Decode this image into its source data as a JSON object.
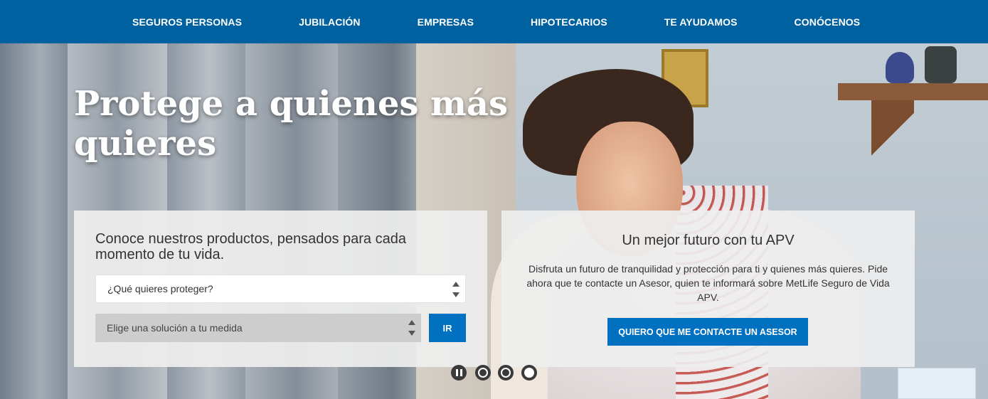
{
  "nav": {
    "items": [
      {
        "label": "SEGUROS PERSONAS"
      },
      {
        "label": "JUBILACIÓN"
      },
      {
        "label": "EMPRESAS"
      },
      {
        "label": "HIPOTECARIOS"
      },
      {
        "label": "TE AYUDAMOS"
      },
      {
        "label": "CONÓCENOS"
      }
    ]
  },
  "hero": {
    "headline": "Protege a quienes más quieres"
  },
  "product_panel": {
    "title": "Conoce nuestros productos, pensados para cada momento de tu vida.",
    "protect_select": "¿Qué quieres proteger?",
    "solution_select": "Elige una solución a tu medida",
    "go_label": "IR"
  },
  "apv_panel": {
    "title": "Un mejor futuro con tu APV",
    "description": "Disfruta un futuro de tranquilidad y protección para ti y quienes más quieres. Pide ahora que te contacte un Asesor, quien te informará sobre MetLife Seguro de Vida APV.",
    "contact_label": "QUIERO QUE ME CONTACTE UN ASESOR"
  },
  "carousel": {
    "slide_count": 3,
    "active_slide": 3,
    "controls": [
      "pause-icon",
      "dot-icon",
      "dot-icon",
      "dot-icon"
    ]
  },
  "colors": {
    "nav_bg": "#0061a0",
    "button_bg": "#0070c0",
    "panel_bg": "#eeeeee",
    "text": "#333333"
  }
}
